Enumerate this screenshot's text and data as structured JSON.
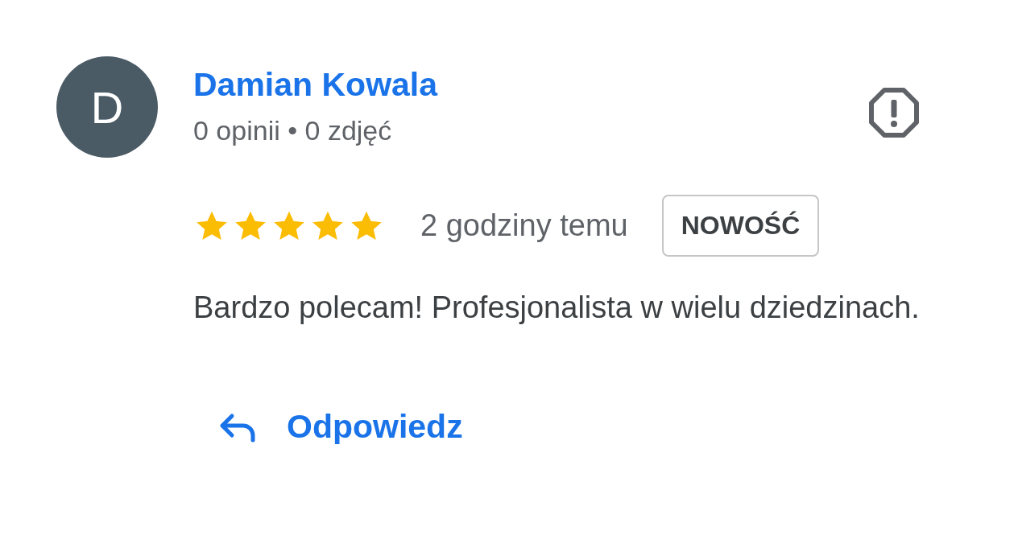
{
  "reviewer": {
    "initial": "D",
    "name": "Damian Kowala",
    "stats": "0 opinii • 0 zdjęć"
  },
  "review": {
    "stars": 5,
    "time": "2 godziny temu",
    "badge": "NOWOŚĆ",
    "text": "Bardzo polecam! Profesjonalista w wielu dziedzinach."
  },
  "reply": {
    "label": "Odpowiedz"
  }
}
